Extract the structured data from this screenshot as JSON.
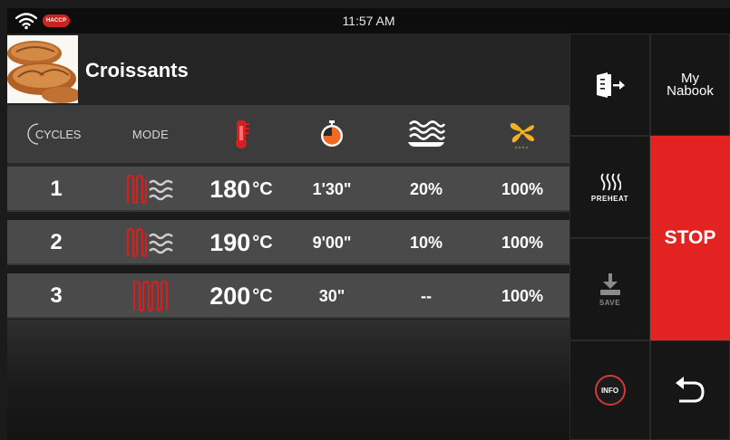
{
  "status_bar": {
    "time": "11:57 AM",
    "haccp_badge": "HACCP",
    "wifi_icon": "wifi-icon"
  },
  "recipe": {
    "title": "Croissants",
    "image_icon": "croissant-photo"
  },
  "table": {
    "headers": {
      "cycles": "CYCLES",
      "mode": "MODE",
      "temperature_icon": "thermometer-icon",
      "time_icon": "timer-icon",
      "humidity_icon": "humidity-icon",
      "fan_icon": "fan-icon"
    },
    "rows": [
      {
        "cycle": "1",
        "mode_icon": "convection-steam-icon",
        "temp": "180",
        "unit": "°C",
        "time": "1'30\"",
        "humidity": "20%",
        "fan": "100%"
      },
      {
        "cycle": "2",
        "mode_icon": "convection-steam-icon",
        "temp": "190",
        "unit": "°C",
        "time": "9'00\"",
        "humidity": "10%",
        "fan": "100%"
      },
      {
        "cycle": "3",
        "mode_icon": "convection-icon",
        "temp": "200",
        "unit": "°C",
        "time": "30\"",
        "humidity": "--",
        "fan": "100%"
      }
    ]
  },
  "right_panel": {
    "export_icon": "export-icon",
    "mynabook_line1": "My",
    "mynabook_line2": "Nabook",
    "preheat_label": "PREHEAT",
    "save_label": "SAVE",
    "stop_label": "STOP",
    "info_label": "INFO",
    "back_icon": "back-arrow-icon"
  },
  "colors": {
    "accent_red": "#e32322",
    "icon_red": "#c9241f",
    "fan_yellow": "#f2b21f",
    "timer_orange": "#f06a23"
  }
}
